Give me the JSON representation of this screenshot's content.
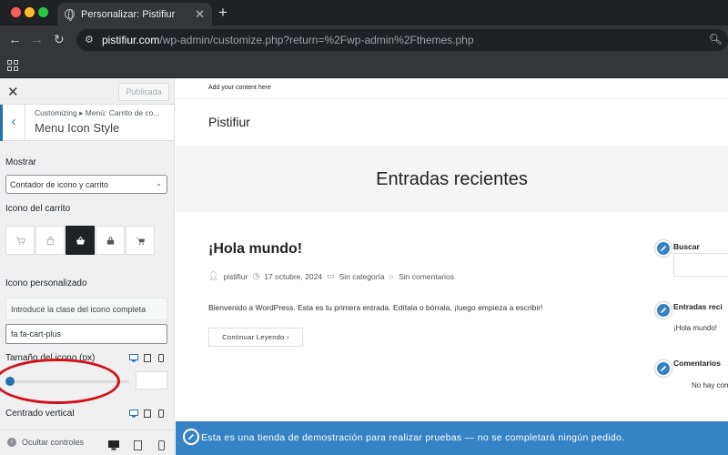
{
  "browser": {
    "tab_title": "Personalizar: Pistifiur",
    "tab_close": "✕",
    "new_tab": "+",
    "url_host": "pistifiur.com",
    "url_path": "/wp-admin/customize.php?return=%2Fwp-admin%2Fthemes.php"
  },
  "sidebar": {
    "close": "✕",
    "publish_label": "Publicada",
    "breadcrumb": "Customizing ▸ Menú: Carrito de co...",
    "section_title": "Menu Icon Style",
    "show_label": "Mostrar",
    "show_value": "Contador de icono y carrito",
    "cart_icon_label": "Icono del carrito",
    "custom_icon_label": "Icono personalizado",
    "custom_icon_info": "Introduce la clase del icono completa",
    "custom_icon_value": "fa fa-cart-plus",
    "icon_size_label": "Tamaño del icono (px)",
    "centered_label": "Centrado vertical",
    "hide_controls": "Ocultar controles"
  },
  "preview": {
    "top_note": "Add your content here",
    "site_title": "Pistifiur",
    "hero_title": "Entradas recientes",
    "post_title": "¡Hola mundo!",
    "meta_author": "pistifiur",
    "meta_date": "17 octubre, 2024",
    "meta_category": "Sin categoría",
    "meta_comments": "Sin comentarios",
    "excerpt": "Bienvenido a WordPress. Esta es tu primera entrada. Edítala o bórrala, ¡luego empieza a escribir!",
    "read_more": "Continuar Leyendo",
    "widget_search": "Buscar",
    "widget_recent": "Entradas reci",
    "widget_recent_item": "¡Hola mundo!",
    "widget_comments": "Comentarios",
    "widget_comments_text": "No hay com",
    "demo_banner": "Esta es una tienda de demostración para realizar pruebas — no se completará ningún pedido."
  },
  "icons": [
    "globe-icon",
    "back-icon",
    "forward-icon",
    "reload-icon",
    "site-settings-icon",
    "zoom-icon",
    "apps-icon",
    "close-icon",
    "chevron-left-icon",
    "chevron-down-icon",
    "cart-icon",
    "basket-icon",
    "bag-icon",
    "desktop-icon",
    "tablet-icon",
    "mobile-icon",
    "pencil-icon",
    "user-icon",
    "clock-icon",
    "folder-icon",
    "comment-icon"
  ],
  "colors": {
    "accent": "#2271b1",
    "banner": "#3582c4",
    "annotation": "#d0111c",
    "chrome": "#202124"
  }
}
